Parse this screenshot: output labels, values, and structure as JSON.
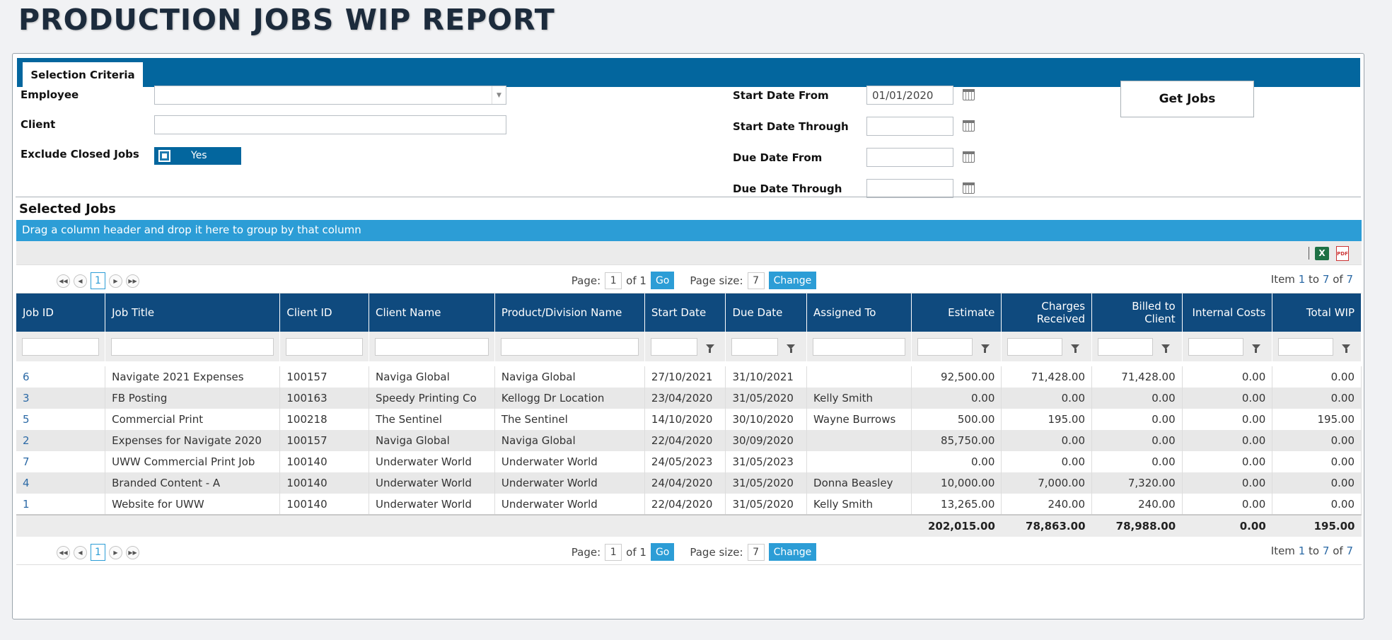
{
  "page": {
    "title": "PRODUCTION JOBS WIP REPORT"
  },
  "tabs": {
    "selection_criteria": "Selection Criteria"
  },
  "criteria": {
    "employee_label": "Employee",
    "employee_value": "",
    "client_label": "Client",
    "client_value": "",
    "exclude_closed_label": "Exclude Closed Jobs",
    "exclude_closed_value": "Yes",
    "start_from_label": "Start Date From",
    "start_from_value": "01/01/2020",
    "start_through_label": "Start Date Through",
    "start_through_value": "",
    "due_from_label": "Due Date From",
    "due_from_value": "",
    "due_through_label": "Due Date Through",
    "due_through_value": "",
    "get_jobs": "Get Jobs"
  },
  "jobs": {
    "section_title": "Selected Jobs",
    "group_hint": "Drag a column header and drop it here to group by that column",
    "columns": [
      "Job ID",
      "Job Title",
      "Client ID",
      "Client Name",
      "Product/Division Name",
      "Start Date",
      "Due Date",
      "Assigned To",
      "Estimate",
      "Charges Received",
      "Billed to Client",
      "Internal Costs",
      "Total WIP"
    ],
    "rows": [
      [
        "6",
        "Navigate 2021 Expenses",
        "100157",
        "Naviga Global",
        "Naviga Global",
        "27/10/2021",
        "31/10/2021",
        "",
        "92,500.00",
        "71,428.00",
        "71,428.00",
        "0.00",
        "0.00"
      ],
      [
        "3",
        "FB Posting",
        "100163",
        "Speedy Printing Co",
        "Kellogg Dr Location",
        "23/04/2020",
        "31/05/2020",
        "Kelly Smith",
        "0.00",
        "0.00",
        "0.00",
        "0.00",
        "0.00"
      ],
      [
        "5",
        "Commercial Print",
        "100218",
        "The Sentinel",
        "The Sentinel",
        "14/10/2020",
        "30/10/2020",
        "Wayne Burrows",
        "500.00",
        "195.00",
        "0.00",
        "0.00",
        "195.00"
      ],
      [
        "2",
        "Expenses for Navigate 2020",
        "100157",
        "Naviga Global",
        "Naviga Global",
        "22/04/2020",
        "30/09/2020",
        "",
        "85,750.00",
        "0.00",
        "0.00",
        "0.00",
        "0.00"
      ],
      [
        "7",
        "UWW Commercial Print Job",
        "100140",
        "Underwater World",
        "Underwater World",
        "24/05/2023",
        "31/05/2023",
        "",
        "0.00",
        "0.00",
        "0.00",
        "0.00",
        "0.00"
      ],
      [
        "4",
        "Branded Content - A",
        "100140",
        "Underwater World",
        "Underwater World",
        "24/04/2020",
        "31/05/2020",
        "Donna Beasley",
        "10,000.00",
        "7,000.00",
        "7,320.00",
        "0.00",
        "0.00"
      ],
      [
        "1",
        "Website for UWW",
        "100140",
        "Underwater World",
        "Underwater World",
        "22/04/2020",
        "31/05/2020",
        "Kelly Smith",
        "13,265.00",
        "240.00",
        "240.00",
        "0.00",
        "0.00"
      ]
    ],
    "totals": {
      "estimate": "202,015.00",
      "charges": "78,863.00",
      "billed": "78,988.00",
      "internal": "0.00",
      "wip": "195.00"
    }
  },
  "pager": {
    "current_page": "1",
    "page_label": "Page:",
    "page_value": "1",
    "of_text": "of 1",
    "go": "Go",
    "size_label": "Page size:",
    "size_value": "7",
    "change": "Change",
    "item_label": "Item",
    "item_from": "1",
    "to_label": "to",
    "item_to": "7",
    "of_label": "of",
    "item_total": "7"
  },
  "export": {
    "excel_icon": "excel-icon",
    "pdf_icon": "pdf-icon",
    "pdf_text": "PDF"
  }
}
